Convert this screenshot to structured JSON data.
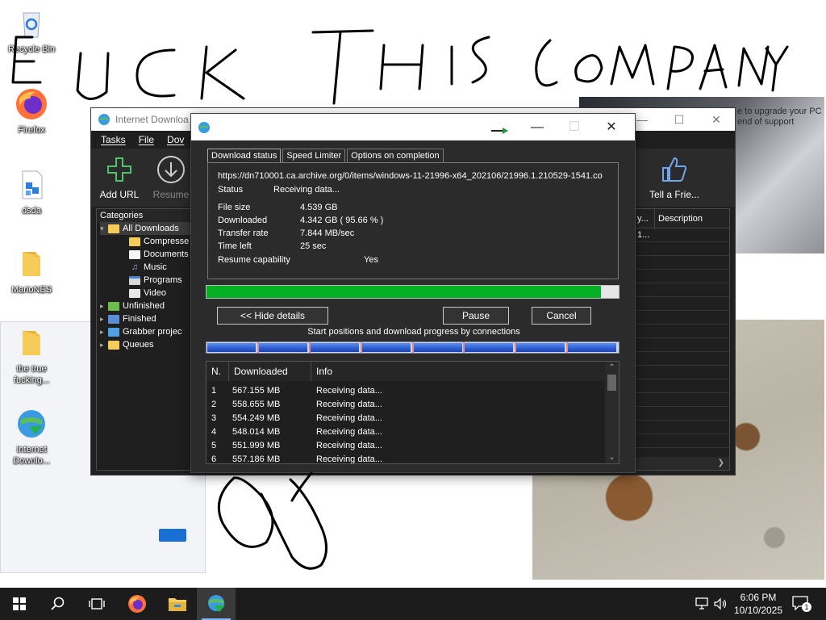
{
  "desktop": {
    "icons": [
      {
        "label": "Recycle Bin"
      },
      {
        "label": "Firefox"
      },
      {
        "label": "dsda"
      },
      {
        "label": "MarioNES"
      },
      {
        "label": "the true fucking..."
      },
      {
        "label": "Internet Downlo..."
      }
    ],
    "scribble_text": "FUCK THIS COMPANY",
    "monitor_text": "e to upgrade your PC end of support"
  },
  "idm_main": {
    "title": "Internet Downloa",
    "menu": [
      "Tasks",
      "File",
      "Dov"
    ],
    "toolbar": {
      "add_url": "Add URL",
      "resume": "Resume",
      "tell_friend": "Tell a Frie..."
    },
    "categories": {
      "header": "Categories",
      "items": [
        {
          "label": "All Downloads"
        },
        {
          "label": "Compresse"
        },
        {
          "label": "Documents"
        },
        {
          "label": "Music"
        },
        {
          "label": "Programs"
        },
        {
          "label": "Video"
        },
        {
          "label": "Unfinished"
        },
        {
          "label": "Finished"
        },
        {
          "label": "Grabber projec"
        },
        {
          "label": "Queues"
        }
      ]
    },
    "list": {
      "col_partial": "y...",
      "col_description": "Description",
      "cell_partial": "1..."
    }
  },
  "dialog": {
    "tabs": [
      "Download status",
      "Speed Limiter",
      "Options on completion"
    ],
    "url": "https://dn710001.ca.archive.org/0/items/windows-11-21996-x64_202106/21996.1.210529-1541.co",
    "status_label": "Status",
    "status_value": "Receiving data...",
    "file_size_label": "File size",
    "file_size_value": "4.539  GB",
    "downloaded_label": "Downloaded",
    "downloaded_value": "4.342  GB  ( 95.66 % )",
    "transfer_rate_label": "Transfer rate",
    "transfer_rate_value": "7.844  MB/sec",
    "time_left_label": "Time left",
    "time_left_value": "25 sec",
    "resume_label": "Resume capability",
    "resume_value": "Yes",
    "progress_fraction": 0.9566,
    "hide_details": "<< Hide details",
    "pause": "Pause",
    "cancel": "Cancel",
    "connections_label": "Start positions and download progress by connections",
    "connections_count": 8,
    "table": {
      "headers": [
        "N.",
        "Downloaded",
        "Info"
      ],
      "rows": [
        {
          "n": "1",
          "downloaded": "567.155  MB",
          "info": "Receiving data..."
        },
        {
          "n": "2",
          "downloaded": "558.655  MB",
          "info": "Receiving data..."
        },
        {
          "n": "3",
          "downloaded": "554.249  MB",
          "info": "Receiving data..."
        },
        {
          "n": "4",
          "downloaded": "548.014  MB",
          "info": "Receiving data..."
        },
        {
          "n": "5",
          "downloaded": "551.999  MB",
          "info": "Receiving data..."
        },
        {
          "n": "6",
          "downloaded": "557.186  MB",
          "info": "Receiving data..."
        }
      ]
    }
  },
  "taskbar": {
    "time": "6:06 PM",
    "date": "10/10/2025",
    "notification_count": "1"
  },
  "colors": {
    "progress": "#06b025",
    "taskbar": "#1c1c1c",
    "dialog_bg": "#2b2b2b"
  }
}
